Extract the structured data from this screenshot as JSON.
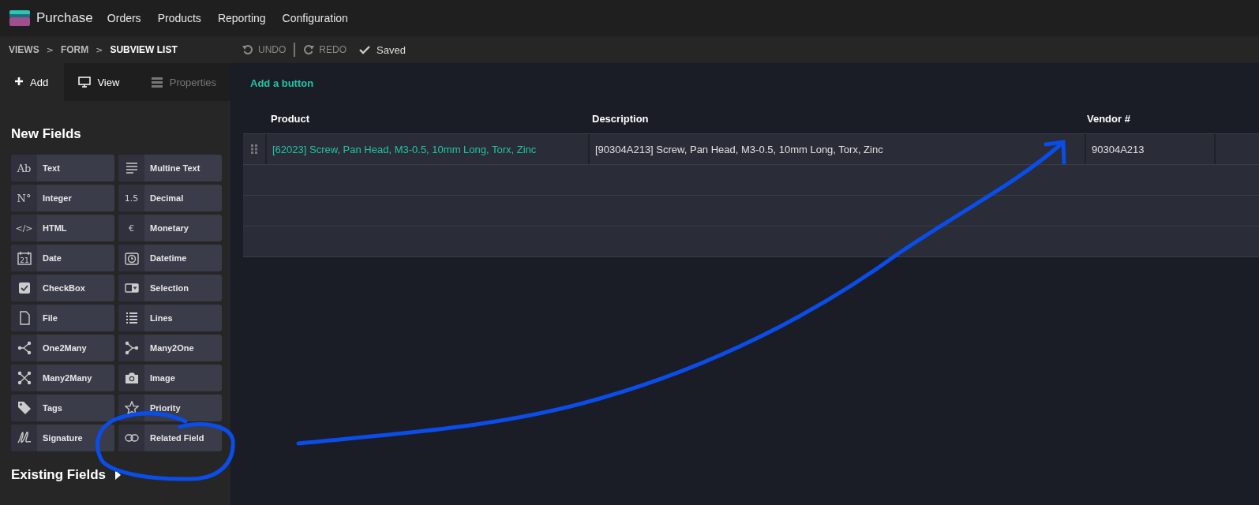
{
  "navbar": {
    "app": "Purchase",
    "menu": [
      {
        "label": "Orders"
      },
      {
        "label": "Products"
      },
      {
        "label": "Reporting"
      },
      {
        "label": "Configuration"
      }
    ]
  },
  "toolbar": {
    "breadcrumbs": [
      {
        "label": "VIEWS",
        "current": false
      },
      {
        "label": "FORM",
        "current": false
      },
      {
        "label": "SUBVIEW LIST",
        "current": true
      }
    ],
    "separator": ">",
    "undo": {
      "label": "UNDO",
      "disabled": true
    },
    "redo": {
      "label": "REDO",
      "disabled": true
    },
    "status": "Saved"
  },
  "sidebar": {
    "tabs": [
      {
        "label": "Add",
        "kind": "add",
        "selected": true,
        "disabled": false
      },
      {
        "label": "View",
        "kind": "view",
        "selected": false,
        "disabled": false
      },
      {
        "label": "Properties",
        "kind": "properties",
        "selected": false,
        "disabled": true
      }
    ],
    "section_title": "New Fields",
    "fields": [
      {
        "label": "Text",
        "kind": "glyph",
        "glyph": "Ab"
      },
      {
        "label": "Multine Text",
        "kind": "multiline"
      },
      {
        "label": "Integer",
        "kind": "glyph",
        "glyph": "N°"
      },
      {
        "label": "Decimal",
        "kind": "glyph",
        "glyph": "1.5"
      },
      {
        "label": "HTML",
        "kind": "glyph",
        "glyph": "</>"
      },
      {
        "label": "Monetary",
        "kind": "glyph",
        "glyph": "€"
      },
      {
        "label": "Date",
        "kind": "date",
        "glyph": "21"
      },
      {
        "label": "Datetime",
        "kind": "datetime"
      },
      {
        "label": "CheckBox",
        "kind": "checkbox"
      },
      {
        "label": "Selection",
        "kind": "selection"
      },
      {
        "label": "File",
        "kind": "file"
      },
      {
        "label": "Lines",
        "kind": "lines"
      },
      {
        "label": "One2Many",
        "kind": "one2many"
      },
      {
        "label": "Many2One",
        "kind": "many2one"
      },
      {
        "label": "Many2Many",
        "kind": "many2many"
      },
      {
        "label": "Image",
        "kind": "image"
      },
      {
        "label": "Tags",
        "kind": "tags"
      },
      {
        "label": "Priority",
        "kind": "priority"
      },
      {
        "label": "Signature",
        "kind": "signature"
      },
      {
        "label": "Related Field",
        "kind": "related"
      }
    ],
    "existing_title": "Existing Fields",
    "existing_expanded": false
  },
  "editor": {
    "add_button": "Add a button",
    "table": {
      "columns": [
        "Product",
        "Description",
        "Vendor #"
      ],
      "rows": [
        [
          "[62023] Screw, Pan Head, M3-0.5, 10mm Long, Torx, Zinc",
          "[90304A213] Screw, Pan Head, M3-0.5, 10mm Long, Torx, Zinc",
          "90304A213"
        ]
      ]
    }
  },
  "annotations": {
    "arrow": true,
    "circle": true
  }
}
